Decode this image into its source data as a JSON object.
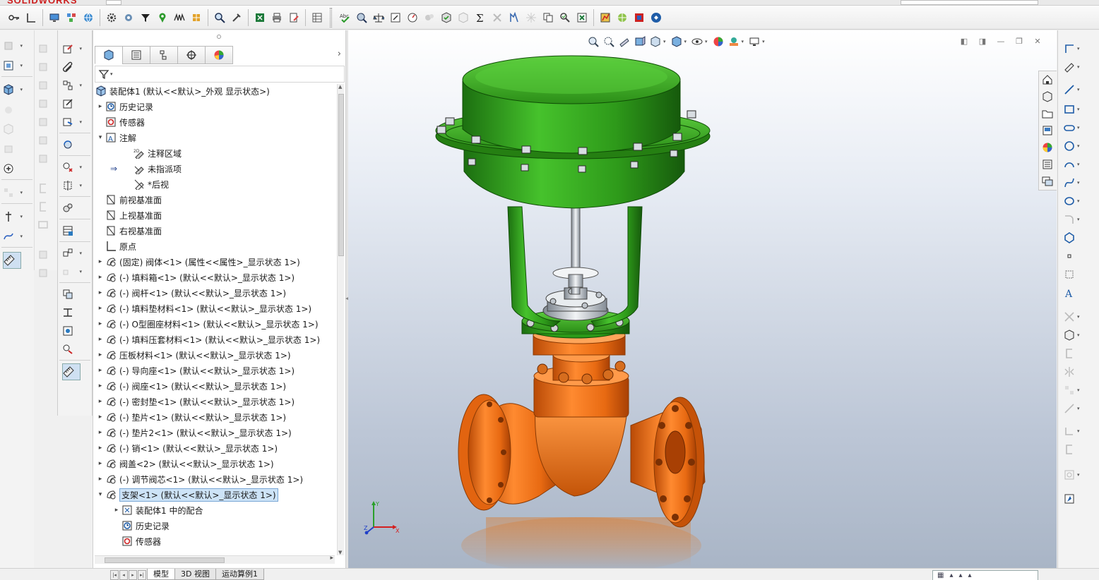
{
  "app": {
    "brand": "SOLIDWORKS"
  },
  "feature_tree": {
    "root": "装配体1  (默认<<默认>_外观 显示状态>)",
    "items": [
      {
        "label": "历史记录",
        "indent": 1,
        "toggle": "▸",
        "icon": "history-icon"
      },
      {
        "label": "传感器",
        "indent": 1,
        "toggle": "",
        "icon": "sensor-icon"
      },
      {
        "label": "注解",
        "indent": 1,
        "toggle": "▾",
        "icon": "annotation-icon"
      },
      {
        "label": "注释区域",
        "indent": 3,
        "toggle": "",
        "icon": "annotation-area-icon"
      },
      {
        "label": "未指派项",
        "indent": 3,
        "toggle": "",
        "icon": "unassigned-icon"
      },
      {
        "label": "*后视",
        "indent": 3,
        "toggle": "",
        "icon": "view-icon"
      },
      {
        "label": "前视基准面",
        "indent": 1,
        "toggle": "",
        "icon": "plane-icon"
      },
      {
        "label": "上视基准面",
        "indent": 1,
        "toggle": "",
        "icon": "plane-icon"
      },
      {
        "label": "右视基准面",
        "indent": 1,
        "toggle": "",
        "icon": "plane-icon"
      },
      {
        "label": "原点",
        "indent": 1,
        "toggle": "",
        "icon": "origin-icon"
      },
      {
        "label": "(固定) 阀体<1> (属性<<属性>_显示状态 1>)",
        "indent": 1,
        "toggle": "▸",
        "icon": "assembly-component-icon"
      },
      {
        "label": "(-) 填料箱<1> (默认<<默认>_显示状态 1>)",
        "indent": 1,
        "toggle": "▸",
        "icon": "assembly-component-icon"
      },
      {
        "label": "(-) 阀杆<1> (默认<<默认>_显示状态 1>)",
        "indent": 1,
        "toggle": "▸",
        "icon": "assembly-component-icon"
      },
      {
        "label": "(-) 填料垫材料<1> (默认<<默认>_显示状态 1>)",
        "indent": 1,
        "toggle": "▸",
        "icon": "assembly-component-icon"
      },
      {
        "label": "(-) O型圈座材料<1> (默认<<默认>_显示状态 1>)",
        "indent": 1,
        "toggle": "▸",
        "icon": "assembly-component-icon"
      },
      {
        "label": "(-) 填料压套材料<1> (默认<<默认>_显示状态 1>)",
        "indent": 1,
        "toggle": "▸",
        "icon": "assembly-component-icon"
      },
      {
        "label": "压板材料<1> (默认<<默认>_显示状态 1>)",
        "indent": 1,
        "toggle": "▸",
        "icon": "assembly-component-icon"
      },
      {
        "label": "(-) 导向座<1> (默认<<默认>_显示状态 1>)",
        "indent": 1,
        "toggle": "▸",
        "icon": "assembly-component-icon"
      },
      {
        "label": "(-) 阀座<1> (默认<<默认>_显示状态 1>)",
        "indent": 1,
        "toggle": "▸",
        "icon": "assembly-component-icon"
      },
      {
        "label": "(-) 密封垫<1> (默认<<默认>_显示状态 1>)",
        "indent": 1,
        "toggle": "▸",
        "icon": "assembly-component-icon"
      },
      {
        "label": "(-) 垫片<1> (默认<<默认>_显示状态 1>)",
        "indent": 1,
        "toggle": "▸",
        "icon": "assembly-component-icon"
      },
      {
        "label": "(-) 垫片2<1> (默认<<默认>_显示状态 1>)",
        "indent": 1,
        "toggle": "▸",
        "icon": "assembly-component-icon"
      },
      {
        "label": "(-) 销<1> (默认<<默认>_显示状态 1>)",
        "indent": 1,
        "toggle": "▸",
        "icon": "assembly-component-icon"
      },
      {
        "label": "阀盖<2> (默认<<默认>_显示状态 1>)",
        "indent": 1,
        "toggle": "▸",
        "icon": "assembly-component-icon"
      },
      {
        "label": "(-) 调节阀芯<1> (默认<<默认>_显示状态 1>)",
        "indent": 1,
        "toggle": "▸",
        "icon": "assembly-component-icon"
      },
      {
        "label": "支架<1> (默认<<默认>_显示状态 1>)",
        "indent": 1,
        "toggle": "▾",
        "icon": "assembly-component-icon",
        "selected": true
      },
      {
        "label": "装配体1 中的配合",
        "indent": 2,
        "toggle": "▸",
        "icon": "mates-icon"
      },
      {
        "label": "历史记录",
        "indent": 2,
        "toggle": "",
        "icon": "history-icon"
      },
      {
        "label": "传感器",
        "indent": 2,
        "toggle": "",
        "icon": "sensor-icon"
      }
    ]
  },
  "bottom_tabs": [
    {
      "label": "模型",
      "active": true
    },
    {
      "label": "3D 视图",
      "active": false
    },
    {
      "label": "运动算例1",
      "active": false
    }
  ],
  "triad": {
    "x": "X",
    "y": "Y",
    "z": "Z"
  },
  "colors": {
    "actuator_green": "#2e9a1a",
    "valve_orange": "#e86a12",
    "selection_blue": "#cde3f7",
    "brand_red": "#cc1f1f"
  }
}
